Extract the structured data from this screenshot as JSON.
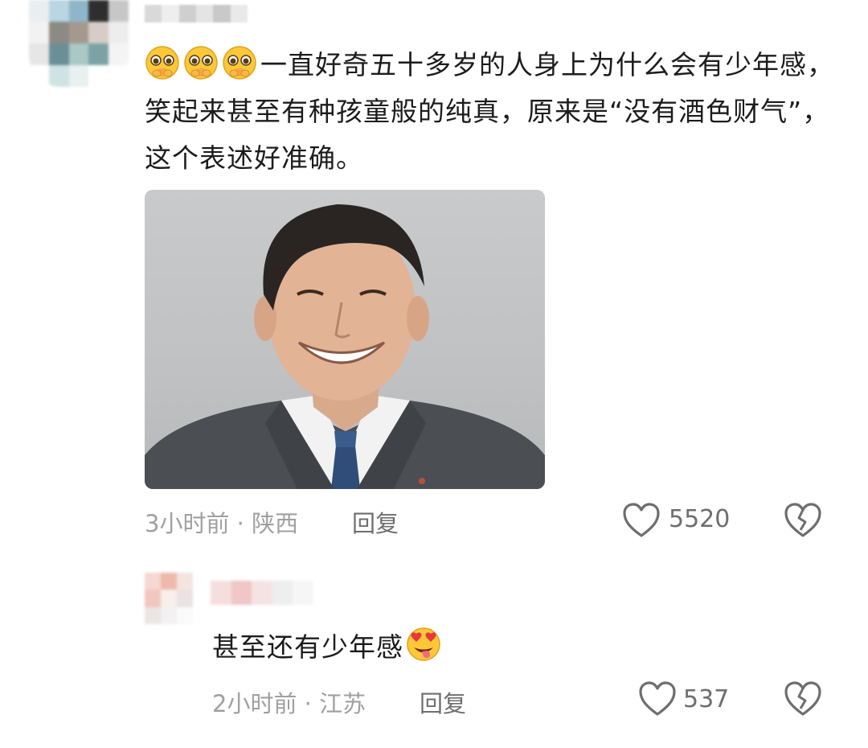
{
  "comment1": {
    "text": "一直好奇五十多岁的人身上为什么会有少年感，笑起来甚至有种孩童般的纯真，原来是“没有酒色财气”，这个表述好准确。",
    "leading_emojis": [
      "pleading-face",
      "pleading-face",
      "pleading-face"
    ],
    "time_location": "3小时前 · 陕西",
    "reply_label": "回复",
    "like_count": "5520",
    "photo": {
      "background": "#c4c5c6",
      "suit": "#4a4d52",
      "tie": "#2f4d78"
    }
  },
  "comment2": {
    "text": "甚至还有少年感",
    "trailing_emoji": "star-struck-tongue-face",
    "time_location": "2小时前 · 江苏",
    "reply_label": "回复",
    "like_count": "537"
  },
  "colors": {
    "meta": "#a0a0a0",
    "action": "#6e6e6e",
    "text": "#1c1c1c"
  }
}
